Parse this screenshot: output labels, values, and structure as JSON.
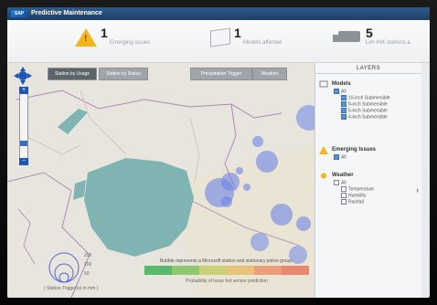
{
  "app": {
    "title": "Predictive Maintenance",
    "logo": "SAP"
  },
  "kpis": [
    {
      "value": "1",
      "label": "Emerging issues",
      "icon": "warning-icon",
      "color": "#f3b51a"
    },
    {
      "value": "1",
      "label": "Models affected",
      "icon": "box-icon"
    },
    {
      "value": "5",
      "label": "Lim INK stations a",
      "icon": "truck-icon"
    }
  ],
  "map": {
    "tabs": [
      "Station by Usage",
      "Station by Status",
      "Precipitation Trigger",
      "Weather"
    ],
    "legend": {
      "caption": "( Station Trigger(s) in mm )",
      "values": [
        "200",
        "100",
        "50"
      ]
    },
    "explanation": "Bubble represents a Microsoft station and stationary police group",
    "scale_caption": "Probability of issue hot sensor prediction",
    "scale_colors": [
      "#58b86c",
      "#8cc96f",
      "#c9d07a",
      "#e8c17a",
      "#eb9e7a",
      "#e8876e"
    ]
  },
  "layers": {
    "title": "LAYERS",
    "models": {
      "title": "Models",
      "items": [
        "All",
        "10-inch Submersible",
        "8-inch Submersible",
        "6-inch Submersible",
        "4-inch Submersible"
      ]
    },
    "issues": {
      "title": "Emerging Issues",
      "items": [
        "All"
      ]
    },
    "weather": {
      "title": "Weather",
      "items": [
        "All",
        "Temperature",
        "Humidity",
        "Rainfall"
      ]
    }
  },
  "colors": {
    "accent": "#2f5a86",
    "bubble": "#6c86e6",
    "lake": "#7fb4b3"
  }
}
